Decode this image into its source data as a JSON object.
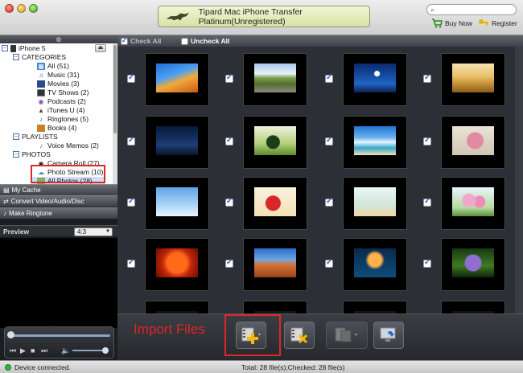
{
  "window": {
    "title": "Tipard Mac iPhone Transfer Platinum(Unregistered)"
  },
  "toolbar": {
    "search_placeholder": "",
    "buy_now": "Buy Now",
    "register": "Register"
  },
  "tree": {
    "device": "iPhone 5",
    "categories_header": "CATEGORIES",
    "categories": [
      {
        "label": "All (51)",
        "icon": "all-icon"
      },
      {
        "label": "Music (31)",
        "icon": "music-note-icon"
      },
      {
        "label": "Movies (3)",
        "icon": "movie-icon"
      },
      {
        "label": "TV Shows (2)",
        "icon": "tv-icon"
      },
      {
        "label": "Podcasts (2)",
        "icon": "podcast-icon"
      },
      {
        "label": "iTunes U (4)",
        "icon": "graduation-cap-icon"
      },
      {
        "label": "Ringtones (5)",
        "icon": "bell-icon"
      },
      {
        "label": "Books (4)",
        "icon": "book-icon"
      }
    ],
    "playlists_header": "PLAYLISTS",
    "playlists": [
      {
        "label": "Voice Memos (2)",
        "icon": "voice-memo-icon"
      }
    ],
    "photos_header": "PHOTOS",
    "photos": [
      {
        "label": "Camera Roll (27)",
        "icon": "camera-icon"
      },
      {
        "label": "Photo Stream (10)",
        "icon": "cloud-icon"
      },
      {
        "label": "All Photos (28)",
        "icon": "photos-icon"
      }
    ]
  },
  "left_panel": {
    "my_cache": "My Cache",
    "convert": "Convert Video/Audio/Disc",
    "make_ringtone": "Make Ringtone",
    "preview_label": "Preview",
    "preview_ratio": "4:3"
  },
  "checkbar": {
    "check_all": "Check All",
    "uncheck_all": "Uncheck All"
  },
  "photos_grid": {
    "checked": true,
    "thumbnails": [
      "autumn-trees",
      "country-road",
      "moon-night",
      "wheat-field",
      "night-sky",
      "green-berries",
      "beach-waves",
      "pink-flower",
      "sky-heart",
      "cartoon-lovers",
      "illustrated-card",
      "pink-flowers",
      "red-dahlia",
      "desert-rocks",
      "jellyfish",
      "purple-flower",
      "dark-a",
      "dark-b",
      "dark-c",
      "dark-d"
    ]
  },
  "annotation": {
    "import_files": "Import Files"
  },
  "status": {
    "connection": "Device connected.",
    "summary": "Total: 28 file(s);Checked: 28 file(s)"
  },
  "colors": {
    "annotation_red": "#e0262a",
    "accent_blue": "#2a66c9"
  }
}
